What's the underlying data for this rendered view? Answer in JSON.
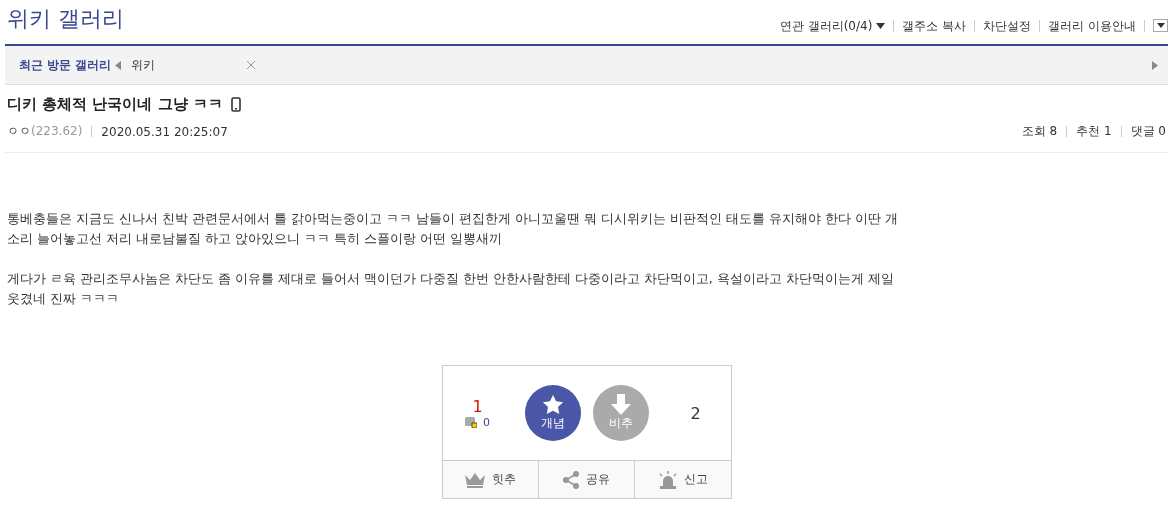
{
  "gallery_title": "위키 갤러리",
  "top_links": [
    {
      "label": "연관 갤러리(0/4)",
      "dropdown": true
    },
    {
      "label": "갤주소 복사",
      "dropdown": false
    },
    {
      "label": "차단설정",
      "dropdown": false
    },
    {
      "label": "갤러리 이용안내",
      "dropdown": false
    }
  ],
  "recent_bar": {
    "label": "최근 방문 갤러리",
    "items": [
      "위키"
    ]
  },
  "post": {
    "title": "디키 총체적 난국이네 그냥 ㅋㅋ",
    "mobile": true,
    "author": "ㅇㅇ",
    "ip": "(223.62)",
    "date": "2020.05.31 20:25:07",
    "stats": [
      "조회 8",
      "추천 1",
      "댓글 0"
    ],
    "paragraphs": [
      [
        "통베충들은 지금도 신나서 친박 관련문서에서 틀 갉아먹는중이고 ㅋㅋ 남들이 편집한게 아니꼬울땐 뭐 디시위키는 비판적인 태도를 유지해야 한다 이딴 개",
        "소리 늘어놓고선 저리 내로남불질 하고 앉아있으니 ㅋㅋ 특히 스플이랑 어떤 일뽕새끼"
      ],
      [
        "게다가 ㄹ육 관리조무사놈은 차단도 좀 이유를 제대로 들어서 맥이던가 다중질 한번 안한사람한테 다중이라고 차단먹이고, 욕설이라고 차단먹이는게 제일",
        "웃겼네 진짜 ㅋㅋㅋ"
      ]
    ]
  },
  "vote": {
    "up_count": "1",
    "fixed_count": "0",
    "up_label": "개념",
    "down_label": "비추",
    "down_count": "2"
  },
  "actions": [
    {
      "kind": "crown",
      "label": "힛추"
    },
    {
      "kind": "share",
      "label": "공유"
    },
    {
      "kind": "siren",
      "label": "신고"
    }
  ]
}
